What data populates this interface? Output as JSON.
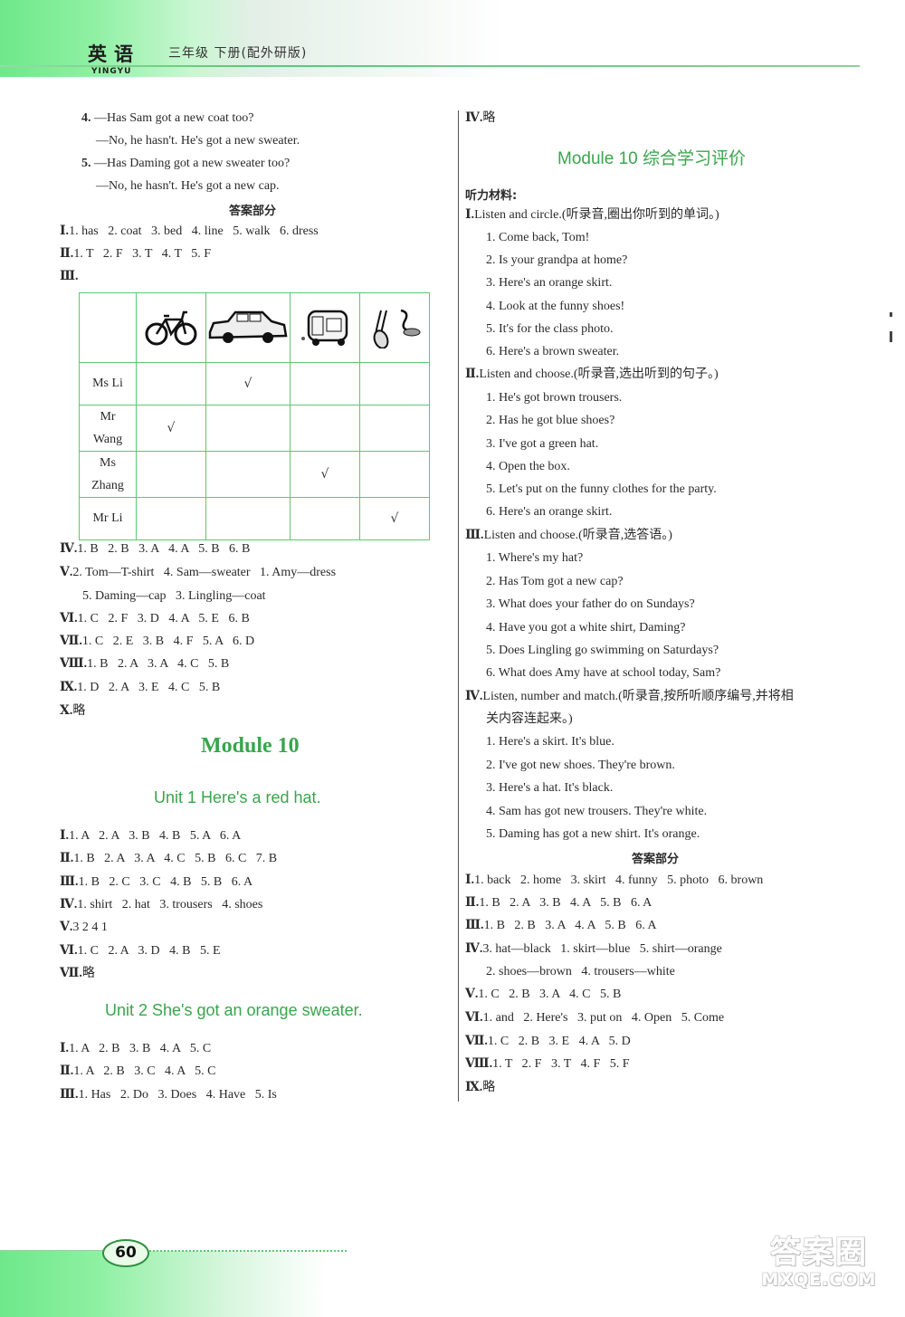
{
  "header": {
    "subject": "英语",
    "subject_pinyin": "YINGYU",
    "grade_info": "三年级   下册(配外研版)"
  },
  "left": {
    "dialogues": [
      {
        "num": "4.",
        "q": "—Has Sam got a new coat too?",
        "a": "—No, he hasn't. He's got a new sweater."
      },
      {
        "num": "5.",
        "q": "—Has Daming got a new sweater too?",
        "a": "—No, he hasn't. He's got a new cap."
      }
    ],
    "answer_heading": "答案部分",
    "answers_a": [
      {
        "roman": "Ⅰ.",
        "text": "1. has   2. coat   3. bed   4. line   5. walk   6. dress"
      },
      {
        "roman": "Ⅱ.",
        "text": "1. T   2. F   3. T   4. T   5. F"
      },
      {
        "roman": "Ⅲ.",
        "text": ""
      }
    ],
    "table": {
      "header_icons": [
        "bicycle",
        "car",
        "bus",
        "shoes"
      ],
      "rows": [
        {
          "name": "Ms Li",
          "checks": [
            "",
            "√",
            "",
            ""
          ]
        },
        {
          "name": "Mr Wang",
          "checks": [
            "√",
            "",
            "",
            ""
          ]
        },
        {
          "name": "Ms Zhang",
          "checks": [
            "",
            "",
            "√",
            ""
          ]
        },
        {
          "name": "Mr Li",
          "checks": [
            "",
            "",
            "",
            "√"
          ]
        }
      ]
    },
    "answers_b": [
      {
        "roman": "Ⅳ.",
        "text": "1. B   2. B   3. A   4. A   5. B   6. B"
      },
      {
        "roman": "Ⅴ.",
        "text": "2. Tom—T-shirt   4. Sam—sweater   1. Amy—dress"
      },
      {
        "roman": "",
        "text": "5. Daming—cap   3. Lingling—coat"
      },
      {
        "roman": "Ⅵ.",
        "text": "1. C   2. F   3. D   4. A   5. E   6. B"
      },
      {
        "roman": "Ⅶ.",
        "text": "1. C   2. E   3. B   4. F   5. A   6. D"
      },
      {
        "roman": "Ⅷ.",
        "text": "1. B   2. A   3. A   4. C   5. B"
      },
      {
        "roman": "Ⅸ.",
        "text": "1. D   2. A   3. E   4. C   5. B"
      },
      {
        "roman": "Ⅹ.",
        "text": "略"
      }
    ],
    "module_title": "Module 10",
    "unit1": {
      "title": "Unit 1    Here's a red hat.",
      "answers": [
        {
          "roman": "Ⅰ.",
          "text": "1. A   2. A   3. B   4. B   5. A   6. A"
        },
        {
          "roman": "Ⅱ.",
          "text": "1. B   2. A   3. A   4. C   5. B   6. C   7. B"
        },
        {
          "roman": "Ⅲ.",
          "text": "1. B   2. C   3. C   4. B   5. B   6. A"
        },
        {
          "roman": "Ⅳ.",
          "text": "1. shirt   2. hat   3. trousers   4. shoes"
        },
        {
          "roman": "Ⅴ.",
          "text": "3 2 4 1"
        },
        {
          "roman": "Ⅵ.",
          "text": "1. C   2. A   3. D   4. B   5. E"
        },
        {
          "roman": "Ⅶ.",
          "text": "略"
        }
      ]
    },
    "unit2": {
      "title": "Unit 2    She's got an orange sweater.",
      "answers": [
        {
          "roman": "Ⅰ.",
          "text": "1. A   2. B   3. B   4. A   5. C"
        },
        {
          "roman": "Ⅱ.",
          "text": "1. A   2. B   3. C   4. A   5. C"
        },
        {
          "roman": "Ⅲ.",
          "text": "1. Has   2. Do   3. Does   4. Have   5. Is"
        }
      ]
    }
  },
  "right": {
    "top_answer": {
      "roman": "Ⅳ.",
      "text": "略"
    },
    "module_review_title": "Module 10 综合学习评价",
    "listening_label": "听力材料:",
    "sections": [
      {
        "roman": "Ⅰ.",
        "title": "Listen and circle.(听录音,圈出你听到的单词。)",
        "items": [
          "1. Come back, Tom!",
          "2. Is your grandpa at home?",
          "3. Here's an orange skirt.",
          "4. Look at the funny shoes!",
          "5. It's for the class photo.",
          "6. Here's a brown sweater."
        ]
      },
      {
        "roman": "Ⅱ.",
        "title": "Listen and choose.(听录音,选出听到的句子。)",
        "items": [
          "1. He's got brown trousers.",
          "2. Has he got blue shoes?",
          "3. I've got a green hat.",
          "4. Open the box.",
          "5. Let's put on the funny clothes for the party.",
          "6. Here's an orange skirt."
        ]
      },
      {
        "roman": "Ⅲ.",
        "title": "Listen and choose.(听录音,选答语。)",
        "items": [
          "1. Where's my hat?",
          "2. Has Tom got a new cap?",
          "3. What does your father do on Sundays?",
          "4. Have you got a white shirt, Daming?",
          "5. Does Lingling go swimming on Saturdays?",
          "6. What does Amy have at school today, Sam?"
        ]
      },
      {
        "roman": "Ⅳ.",
        "title": "Listen, number and match.(听录音,按所听顺序编号,并将相",
        "title_cont": "关内容连起来。)",
        "items": [
          "1. Here's a skirt. It's blue.",
          "2. I've got new shoes. They're brown.",
          "3. Here's a hat. It's black.",
          "4. Sam has got new trousers. They're white.",
          "5. Daming has got a new shirt. It's orange."
        ]
      }
    ],
    "answer_heading": "答案部分",
    "answers": [
      {
        "roman": "Ⅰ.",
        "text": "1. back   2. home   3. skirt   4. funny   5. photo   6. brown"
      },
      {
        "roman": "Ⅱ.",
        "text": "1. B   2. A   3. B   4. A   5. B   6. A"
      },
      {
        "roman": "Ⅲ.",
        "text": "1. B   2. B   3. A   4. A   5. B   6. A"
      },
      {
        "roman": "Ⅳ.",
        "text": "3. hat—black   1. skirt—blue   5. shirt—orange"
      },
      {
        "roman": "",
        "text": "2. shoes—brown   4. trousers—white"
      },
      {
        "roman": "Ⅴ.",
        "text": "1. C   2. B   3. A   4. C   5. B"
      },
      {
        "roman": "Ⅵ.",
        "text": "1. and   2. Here's   3. put on   4. Open   5. Come"
      },
      {
        "roman": "Ⅶ.",
        "text": "1. C   2. B   3. E   4. A   5. D"
      },
      {
        "roman": "Ⅷ.",
        "text": "1. T   2. F   3. T   4. F   5. F"
      },
      {
        "roman": "Ⅸ.",
        "text": "略"
      }
    ]
  },
  "footer": {
    "page_number": "60",
    "watermark_cn": "答案圈",
    "watermark_en": "MXQE.COM"
  },
  "colors": {
    "accent_green": "#3aa54c",
    "table_border": "#5cc872"
  }
}
